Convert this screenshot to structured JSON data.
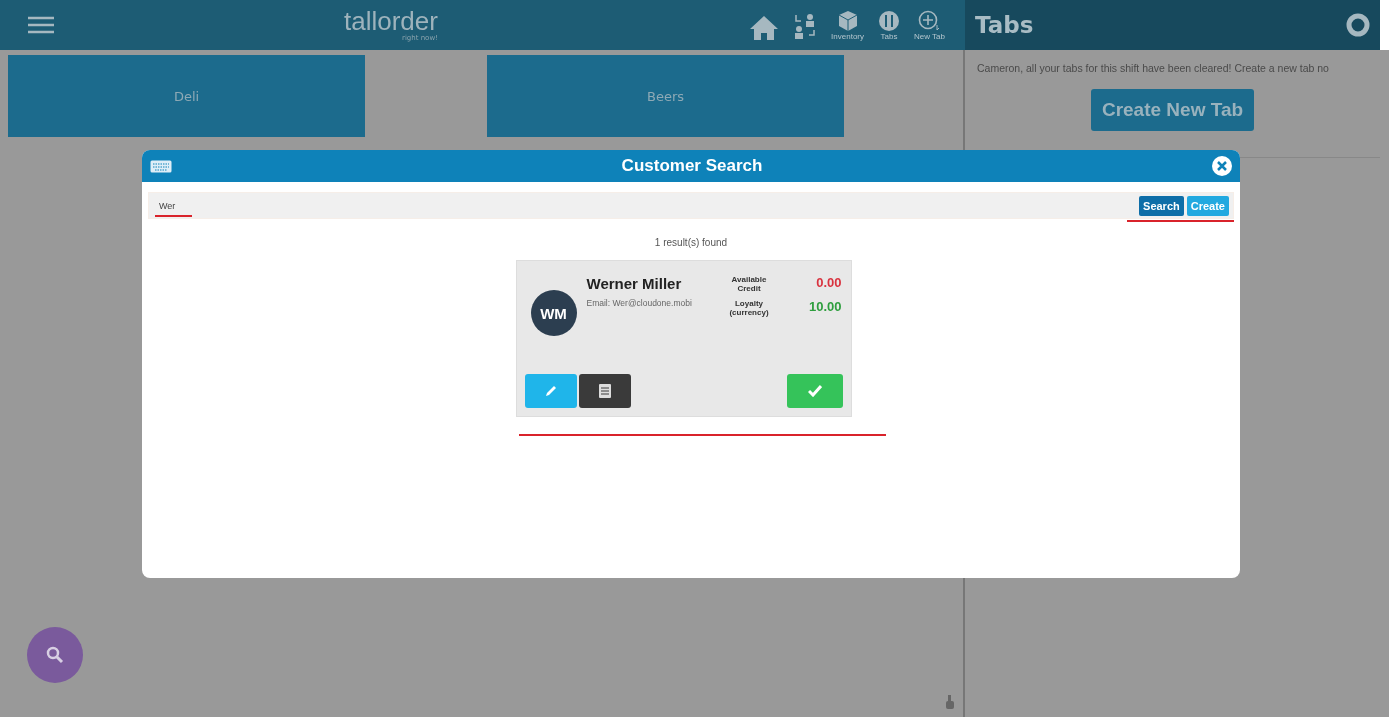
{
  "header": {
    "logo": "tallorder",
    "tagline": "right now!",
    "nav": [
      {
        "kind": "home"
      },
      {
        "kind": "transfer"
      },
      {
        "kind": "inventory",
        "label": "Inventory"
      },
      {
        "kind": "tabs",
        "label": "Tabs"
      },
      {
        "kind": "newtab",
        "label": "New Tab"
      }
    ]
  },
  "categories": [
    {
      "label": "Deli"
    },
    {
      "label": "Beers"
    }
  ],
  "tabs_panel": {
    "title": "Tabs",
    "message": "Cameron, all your tabs for this shift have been cleared! Create a new tab no",
    "button": "Create New Tab"
  },
  "dialog": {
    "title": "Customer Search",
    "search": {
      "value": "Wer"
    },
    "buttons": [
      {
        "kind": "search",
        "label": "Search"
      },
      {
        "kind": "create",
        "label": "Create"
      }
    ],
    "result_count": "1 result(s) found",
    "customers": [
      {
        "initials": "WM",
        "name": "Werner Miller",
        "email": "Email: Wer@cloudone.mobi",
        "stats": [
          {
            "label": "Available Credit",
            "value": "0.00",
            "color": "#d9333f"
          },
          {
            "label": "Loyalty (currency)",
            "value": "10.00",
            "color": "#2e9e3e"
          }
        ]
      }
    ]
  }
}
